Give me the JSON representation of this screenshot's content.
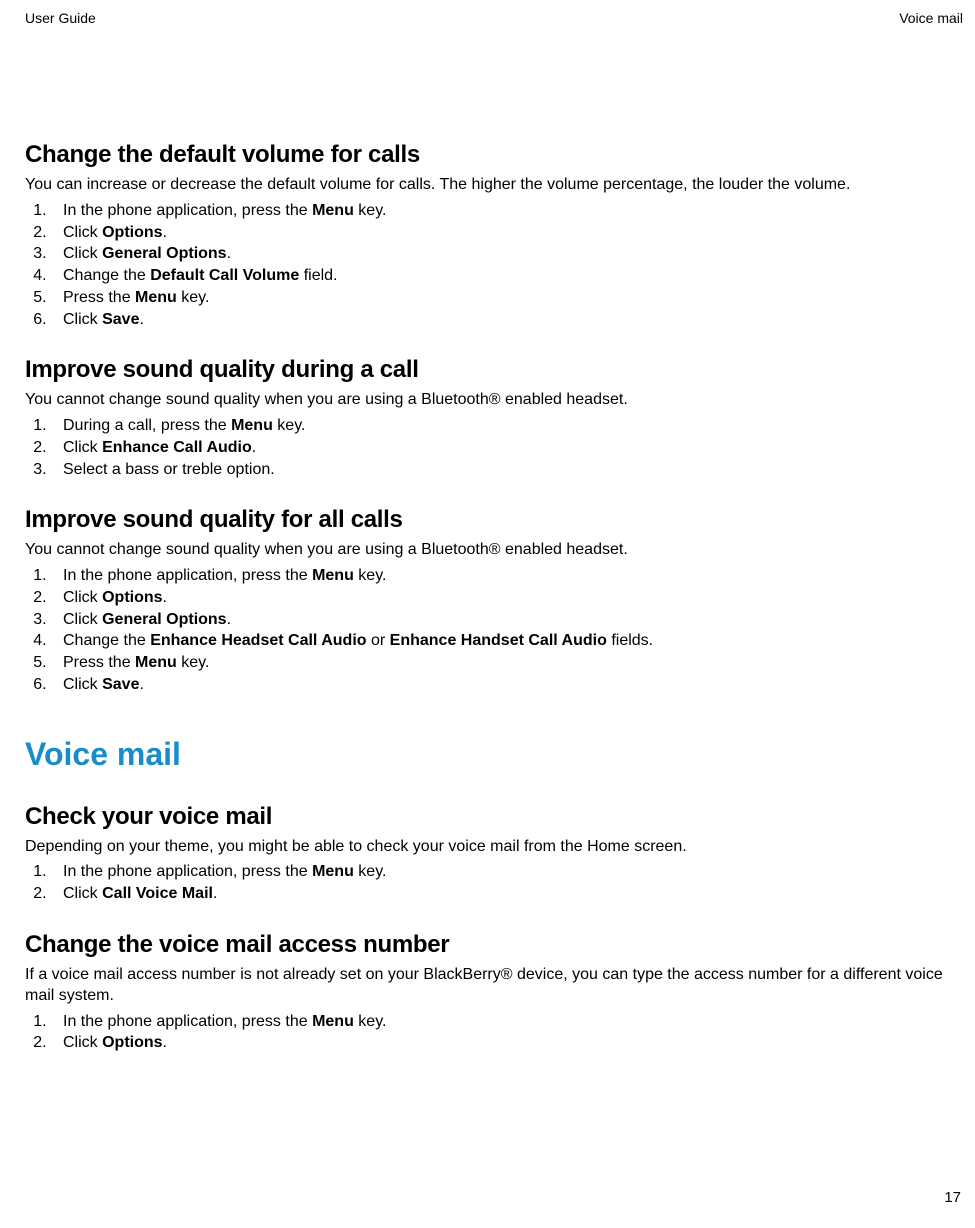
{
  "header": {
    "left": "User Guide",
    "right": "Voice mail"
  },
  "page_number": "17",
  "sections": [
    {
      "heading": "Change the default volume for calls",
      "intro": "You can increase or decrease the default volume for calls. The higher the volume percentage, the louder the volume.",
      "steps": [
        [
          {
            "t": "In the phone application, press the "
          },
          {
            "t": "Menu",
            "b": true
          },
          {
            "t": " key."
          }
        ],
        [
          {
            "t": "Click "
          },
          {
            "t": "Options",
            "b": true
          },
          {
            "t": "."
          }
        ],
        [
          {
            "t": "Click "
          },
          {
            "t": "General Options",
            "b": true
          },
          {
            "t": "."
          }
        ],
        [
          {
            "t": "Change the "
          },
          {
            "t": "Default Call Volume",
            "b": true
          },
          {
            "t": " field."
          }
        ],
        [
          {
            "t": "Press the "
          },
          {
            "t": "Menu",
            "b": true
          },
          {
            "t": " key."
          }
        ],
        [
          {
            "t": "Click "
          },
          {
            "t": "Save",
            "b": true
          },
          {
            "t": "."
          }
        ]
      ]
    },
    {
      "heading": "Improve sound quality during a call",
      "intro": "You cannot change sound quality when you are using a Bluetooth® enabled headset.",
      "steps": [
        [
          {
            "t": "During a call, press the "
          },
          {
            "t": "Menu",
            "b": true
          },
          {
            "t": " key."
          }
        ],
        [
          {
            "t": "Click "
          },
          {
            "t": "Enhance Call Audio",
            "b": true
          },
          {
            "t": "."
          }
        ],
        [
          {
            "t": "Select a bass or treble option."
          }
        ]
      ]
    },
    {
      "heading": "Improve sound quality for all calls",
      "intro": "You cannot change sound quality when you are using a Bluetooth® enabled headset.",
      "steps": [
        [
          {
            "t": "In the phone application, press the "
          },
          {
            "t": "Menu",
            "b": true
          },
          {
            "t": " key."
          }
        ],
        [
          {
            "t": "Click "
          },
          {
            "t": "Options",
            "b": true
          },
          {
            "t": "."
          }
        ],
        [
          {
            "t": "Click "
          },
          {
            "t": "General Options",
            "b": true
          },
          {
            "t": "."
          }
        ],
        [
          {
            "t": "Change the "
          },
          {
            "t": "Enhance Headset Call Audio",
            "b": true
          },
          {
            "t": " or "
          },
          {
            "t": "Enhance Handset Call Audio",
            "b": true
          },
          {
            "t": " fields."
          }
        ],
        [
          {
            "t": "Press the "
          },
          {
            "t": "Menu",
            "b": true
          },
          {
            "t": " key."
          }
        ],
        [
          {
            "t": "Click "
          },
          {
            "t": "Save",
            "b": true
          },
          {
            "t": "."
          }
        ]
      ]
    }
  ],
  "chapter_heading": "Voice mail",
  "chapter_sections": [
    {
      "heading": "Check your voice mail",
      "intro": "Depending on your theme, you might be able to check your voice mail from the Home screen.",
      "steps": [
        [
          {
            "t": "In the phone application, press the "
          },
          {
            "t": "Menu",
            "b": true
          },
          {
            "t": " key."
          }
        ],
        [
          {
            "t": "Click "
          },
          {
            "t": "Call Voice Mail",
            "b": true
          },
          {
            "t": "."
          }
        ]
      ]
    },
    {
      "heading": "Change the voice mail access number",
      "intro": "If a voice mail access number is not already set on your BlackBerry® device, you can type the access number for a different voice mail system.",
      "steps": [
        [
          {
            "t": "In the phone application, press the "
          },
          {
            "t": "Menu",
            "b": true
          },
          {
            "t": " key."
          }
        ],
        [
          {
            "t": "Click "
          },
          {
            "t": "Options",
            "b": true
          },
          {
            "t": "."
          }
        ]
      ]
    }
  ]
}
